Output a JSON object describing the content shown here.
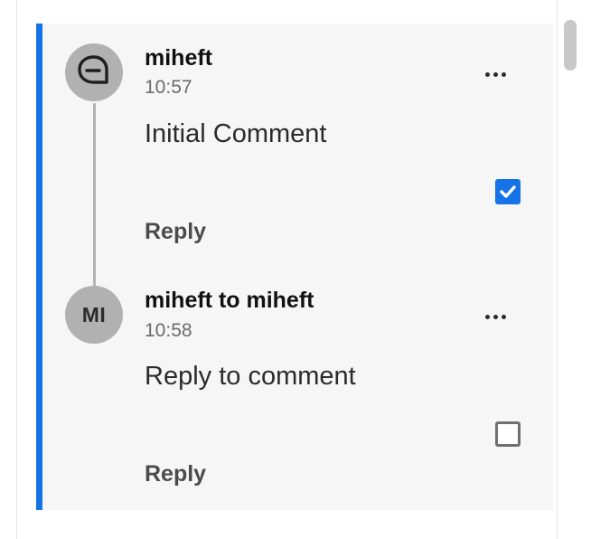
{
  "comments": [
    {
      "avatar_icon": "comment-bubble-icon",
      "author": "miheft",
      "time": "10:57",
      "body": "Initial Comment",
      "resolved": true,
      "reply_label": "Reply",
      "more_icon": "more-horizontal-icon"
    },
    {
      "avatar_initials": "MI",
      "author": "miheft to miheft",
      "time": "10:58",
      "body": "Reply to comment",
      "resolved": false,
      "reply_label": "Reply",
      "more_icon": "more-horizontal-icon"
    }
  ],
  "colors": {
    "accent": "#1473e6",
    "avatar_bg": "#b1b1b1",
    "thread_bg": "#f6f6f6"
  }
}
